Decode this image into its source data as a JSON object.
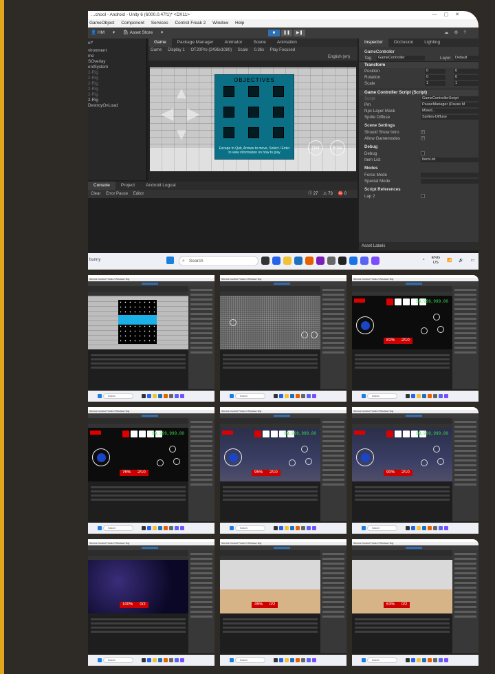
{
  "main": {
    "title": "…chool - Android - Unity 6 (6000.0.47f1)* <DX11>",
    "menu": [
      "GameObject",
      "Component",
      "Services",
      "Control Freak 2",
      "Window",
      "Help"
    ],
    "toolbar": {
      "account": "HM",
      "asset_store": "Asset Store"
    },
    "hierarchy": {
      "items": [
        {
          "label": "el*",
          "dim": false
        },
        {
          "label": "vironment",
          "dim": false
        },
        {
          "label": "me",
          "dim": false
        },
        {
          "label": "SOverlay",
          "dim": false
        },
        {
          "label": "entSystem",
          "dim": false
        },
        {
          "label": "2-Rig",
          "dim": true
        },
        {
          "label": "2-Rig",
          "dim": true
        },
        {
          "label": "2-Rig",
          "dim": true
        },
        {
          "label": "2-Rig",
          "dim": true
        },
        {
          "label": "2-Rig",
          "dim": true
        },
        {
          "label": "2-Rig",
          "dim": false
        },
        {
          "label": "DestroyOnLoad",
          "dim": false
        }
      ]
    },
    "scene_tabs": [
      "Game",
      "Package Manager",
      "Animator",
      "Scene",
      "Animation"
    ],
    "game_bar": {
      "mode": "Game",
      "display": "Display 1",
      "resolution": "OT20Pro (2436x1080)",
      "scale_label": "Scale",
      "scale_value": "0.36x",
      "play_mode": "Play Focused",
      "language": "English (en)"
    },
    "game_view": {
      "box_title": "OBJECTIVES",
      "hint": "Escape to Quit, Arrows to move, Select / Enter to view information on how to play",
      "quit_label": "Quit",
      "enter_label": "Enter"
    },
    "console": {
      "tabs": [
        "Console",
        "Project",
        "Android Logcat"
      ],
      "toolbar": [
        "Clear",
        "Error Pause",
        "Editor"
      ],
      "count_info": "27",
      "count_warn": "73",
      "count_err": "0"
    },
    "inspector": {
      "tabs": [
        "Inspector",
        "Occlusion",
        "Lighting"
      ],
      "object_name": "GameController",
      "tag_label": "Tag",
      "tag_value": "GameController",
      "layer_label": "Layer",
      "layer_value": "Default",
      "transform": {
        "header": "Transform",
        "position": {
          "label": "Position",
          "x": "0",
          "y": "0"
        },
        "rotation": {
          "label": "Rotation",
          "x": "0",
          "y": "0"
        },
        "scale": {
          "label": "Scale",
          "x": "1",
          "y": "1"
        }
      },
      "script_header": "Game Controller Script (Script)",
      "fields": [
        {
          "label": "Script",
          "value": "GameControllerScript",
          "dim": true
        },
        {
          "label": "Pm",
          "value": "PauseManager (Pause M",
          "dim": false
        },
        {
          "label": "Npc Layer Mask",
          "value": "Mixed...",
          "dim": false
        },
        {
          "label": "Sprite Diffuse",
          "value": "Sprites-Diffuse",
          "dim": false
        }
      ],
      "scene_settings": {
        "header": "Scene Settings",
        "intro": "Should Show Intro",
        "gamemodes": "Allow Gamemodes"
      },
      "debug": {
        "header": "Debug",
        "debug_label": "Debug",
        "item_list_label": "Item List",
        "item_list_value": "ItemList"
      },
      "modes": {
        "header": "Modes",
        "force": "Force Mode",
        "special": "Special Mode"
      },
      "script_refs": {
        "header": "Script References",
        "lap": "Lap 2"
      },
      "asset_labels": "Asset Labels"
    },
    "taskbar": {
      "left_text": "bunny",
      "search_placeholder": "Search",
      "lang_top": "ENG",
      "lang_bottom": "US"
    }
  },
  "thumbs": [
    {
      "kind": "starfield",
      "money": "",
      "stamina": "",
      "items": ""
    },
    {
      "kind": "static",
      "money": "",
      "stamina": "",
      "items": ""
    },
    {
      "kind": "hud-dark",
      "money": "$9,999,999.00",
      "stamina": "81%",
      "items": "2/10"
    },
    {
      "kind": "hud-dark",
      "money": "$9,999,999.00",
      "stamina": "76%",
      "items": "2/10"
    },
    {
      "kind": "hud-hall",
      "money": "$9,999,999.00",
      "stamina": "95%",
      "items": "2/10"
    },
    {
      "kind": "hud-hall",
      "money": "$9,999,999.00",
      "stamina": "90%",
      "items": "2/10"
    },
    {
      "kind": "space",
      "money": "",
      "stamina": "100%",
      "items": "0/2"
    },
    {
      "kind": "room",
      "money": "",
      "stamina": "45%",
      "items": "0/2"
    },
    {
      "kind": "room",
      "money": "",
      "stamina": "63%",
      "items": "0/2"
    }
  ],
  "colors": {
    "accent": "#2f6fb5",
    "money": "#38e04a",
    "hud_red": "#c00000",
    "objective_box": "#0b6f86",
    "side_bar": "#e3a51b"
  }
}
